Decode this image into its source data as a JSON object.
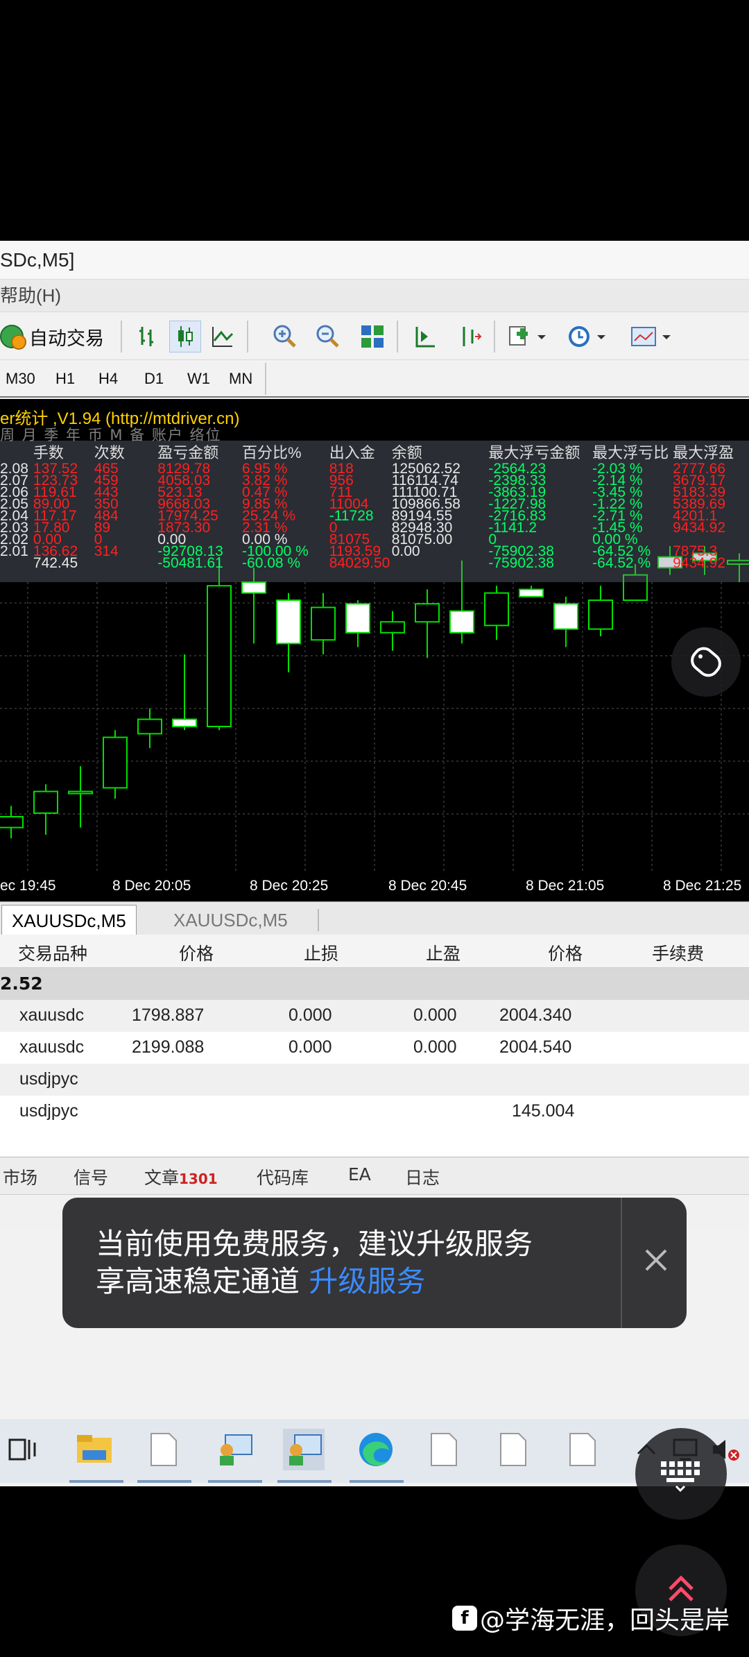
{
  "window": {
    "title": "SDc,M5]",
    "menu": "帮助(H)"
  },
  "toolbar": {
    "auto_trade_label": "自动交易"
  },
  "timeframes": [
    "M30",
    "H1",
    "H4",
    "D1",
    "W1",
    "MN"
  ],
  "ea": {
    "title": "er统计 ,V1.94 (http://mtdriver.cn)",
    "subtitle": "周 月 季 年 币 M 备 账户 络位",
    "headers": [
      "手数",
      "次数",
      "盈亏金额",
      "百分比%",
      "出入金",
      "余额",
      "最大浮亏金额",
      "最大浮亏比",
      "最大浮盈"
    ],
    "rows": [
      [
        "2.08",
        "137.52",
        "465",
        "8129.78",
        "6.95 %",
        "818",
        "125062.52",
        "-2564.23",
        "-2.03 %",
        "2777.66"
      ],
      [
        "2.07",
        "123.73",
        "459",
        "4058.03",
        "3.82 %",
        "956",
        "116114.74",
        "-2398.33",
        "-2.14 %",
        "3679.17"
      ],
      [
        "2.06",
        "119.61",
        "443",
        "523.13",
        "0.47 %",
        "711",
        "111100.71",
        "-3863.19",
        "-3.45 %",
        "5183.39"
      ],
      [
        "2.05",
        "89.00",
        "350",
        "9668.03",
        "9.85 %",
        "11004",
        "109866.58",
        "-1227.98",
        "-1.22 %",
        "5389.69"
      ],
      [
        "2.04",
        "117.17",
        "484",
        "17974.25",
        "25.24 %",
        "-11728",
        "89194.55",
        "-2716.83",
        "-2.71 %",
        "4201.1"
      ],
      [
        "2.03",
        "17.80",
        "89",
        "1873.30",
        "2.31 %",
        "0",
        "82948.30",
        "-1141.2",
        "-1.45 %",
        "9434.92"
      ],
      [
        "2.02",
        "0.00",
        "0",
        "0.00",
        "0.00 %",
        "81075",
        "81075.00",
        "0",
        "0.00 %",
        ""
      ],
      [
        "2.01",
        "136.62",
        "314",
        "-92708.13",
        "-100.00 %",
        "1193.59",
        "0.00",
        "-75902.38",
        "-64.52 %",
        "7875.3"
      ],
      [
        "",
        "742.45",
        "",
        "-50481.61",
        "-60.08 %",
        "84029.50",
        "",
        "-75902.38",
        "-64.52 %",
        "9434.92"
      ]
    ]
  },
  "chart_data": {
    "type": "candlestick",
    "x_tick_labels": [
      "ec 19:45",
      "8 Dec 20:05",
      "8 Dec 20:25",
      "8 Dec 20:45",
      "8 Dec 21:05",
      "8 Dec 21:25"
    ],
    "candles": [
      {
        "o": 0.12,
        "c": 0.15,
        "h": 0.18,
        "l": 0.09,
        "bull": true
      },
      {
        "o": 0.16,
        "c": 0.22,
        "h": 0.24,
        "l": 0.1,
        "bull": true
      },
      {
        "o": 0.22,
        "c": 0.22,
        "h": 0.29,
        "l": 0.12,
        "bull": true
      },
      {
        "o": 0.23,
        "c": 0.37,
        "h": 0.39,
        "l": 0.2,
        "bull": true
      },
      {
        "o": 0.38,
        "c": 0.42,
        "h": 0.45,
        "l": 0.34,
        "bull": true
      },
      {
        "o": 0.4,
        "c": 0.42,
        "h": 0.6,
        "l": 0.39,
        "bull": false
      },
      {
        "o": 0.4,
        "c": 0.79,
        "h": 0.87,
        "l": 0.39,
        "bull": true
      },
      {
        "o": 0.8,
        "c": 0.77,
        "h": 0.84,
        "l": 0.63,
        "bull": false
      },
      {
        "o": 0.75,
        "c": 0.63,
        "h": 0.77,
        "l": 0.55,
        "bull": false
      },
      {
        "o": 0.64,
        "c": 0.73,
        "h": 0.77,
        "l": 0.6,
        "bull": true
      },
      {
        "o": 0.74,
        "c": 0.66,
        "h": 0.75,
        "l": 0.62,
        "bull": false
      },
      {
        "o": 0.66,
        "c": 0.69,
        "h": 0.72,
        "l": 0.61,
        "bull": true
      },
      {
        "o": 0.69,
        "c": 0.74,
        "h": 0.78,
        "l": 0.59,
        "bull": true
      },
      {
        "o": 0.72,
        "c": 0.66,
        "h": 0.86,
        "l": 0.63,
        "bull": false
      },
      {
        "o": 0.68,
        "c": 0.77,
        "h": 0.79,
        "l": 0.64,
        "bull": true
      },
      {
        "o": 0.78,
        "c": 0.76,
        "h": 0.79,
        "l": 0.76,
        "bull": false
      },
      {
        "o": 0.74,
        "c": 0.67,
        "h": 0.76,
        "l": 0.62,
        "bull": false
      },
      {
        "o": 0.67,
        "c": 0.75,
        "h": 0.79,
        "l": 0.65,
        "bull": true
      },
      {
        "o": 0.75,
        "c": 0.82,
        "h": 0.85,
        "l": 0.75,
        "bull": true
      },
      {
        "o": 0.84,
        "c": 0.87,
        "h": 0.9,
        "l": 0.82,
        "bull": false
      },
      {
        "o": 0.88,
        "c": 0.86,
        "h": 0.9,
        "l": 0.82,
        "bull": false
      },
      {
        "o": 0.86,
        "c": 0.85,
        "h": 0.88,
        "l": 0.8,
        "bull": true
      }
    ]
  },
  "chart_tabs": [
    "XAUUSDc,M5",
    "XAUUSDc,M5"
  ],
  "terminal": {
    "headers": [
      "交易品种",
      "价格",
      "止损",
      "止盈",
      "价格",
      "手续费"
    ],
    "balance": "2.52",
    "rows": [
      [
        "xauusdc",
        "1798.887",
        "0.000",
        "0.000",
        "2004.340"
      ],
      [
        "xauusdc",
        "2199.088",
        "0.000",
        "0.000",
        "2004.540"
      ],
      [
        "usdjpyc",
        "",
        "",
        "",
        ""
      ],
      [
        "usdjpyc",
        "",
        "",
        "",
        "145.004"
      ]
    ]
  },
  "bottom_tabs": [
    "市场",
    "信号",
    "文章",
    "代码库",
    "EA",
    "日志"
  ],
  "article_badge": "1301",
  "toast": {
    "line1": "当前使用免费服务，建议升级服务",
    "line2": "享高速稳定通道",
    "link": "升级服务"
  },
  "watermark": {
    "logo": "f",
    "text": "@学海无涯，回头是岸"
  },
  "colors": {
    "bull_candle": "#000000",
    "bear_candle": "#ffffff",
    "candle_stroke": "#00e000",
    "grid": "#555555",
    "stat_green": "#00ff66",
    "stat_red": "#ff2020"
  }
}
